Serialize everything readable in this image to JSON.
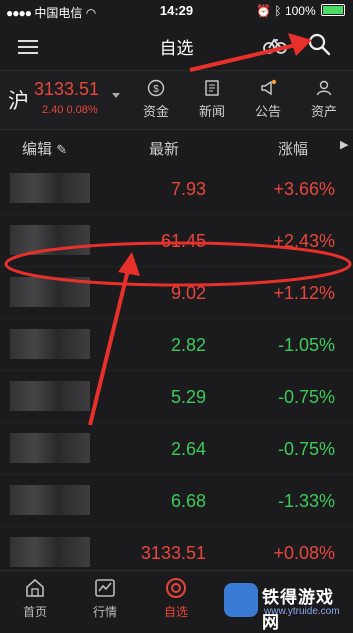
{
  "status_bar": {
    "carrier": "中国电信",
    "time": "14:29",
    "battery": "100%"
  },
  "nav": {
    "title": "自选"
  },
  "index": {
    "name": "沪",
    "value": "3133.51",
    "change": "2.40 0.08%",
    "shortcuts": [
      {
        "label": "资金",
        "icon": "money-icon"
      },
      {
        "label": "新闻",
        "icon": "news-icon"
      },
      {
        "label": "公告",
        "icon": "announcement-icon"
      },
      {
        "label": "资产",
        "icon": "user-icon"
      }
    ]
  },
  "table": {
    "col_edit": "编辑",
    "col_latest": "最新",
    "col_change": "涨幅",
    "rows": [
      {
        "price": "7.93",
        "change": "+3.66%",
        "dir": "up"
      },
      {
        "price": "61.45",
        "change": "+2.43%",
        "dir": "up"
      },
      {
        "price": "9.02",
        "change": "+1.12%",
        "dir": "up"
      },
      {
        "price": "2.82",
        "change": "-1.05%",
        "dir": "down"
      },
      {
        "price": "5.29",
        "change": "-0.75%",
        "dir": "down"
      },
      {
        "price": "2.64",
        "change": "-0.75%",
        "dir": "down"
      },
      {
        "price": "6.68",
        "change": "-1.33%",
        "dir": "down"
      },
      {
        "price": "3133.51",
        "change": "+0.08%",
        "dir": "up"
      }
    ]
  },
  "tabbar": {
    "items": [
      {
        "label": "首页",
        "icon": "home-icon"
      },
      {
        "label": "行情",
        "icon": "chart-icon"
      },
      {
        "label": "自选",
        "icon": "star-icon"
      }
    ]
  },
  "watermark": {
    "title": "铁得游戏网",
    "url": "www.ytruide.com"
  },
  "colors": {
    "up": "#e8463d",
    "down": "#3ec95b",
    "bg": "#1b1b1d",
    "annotation": "#e8302b"
  }
}
